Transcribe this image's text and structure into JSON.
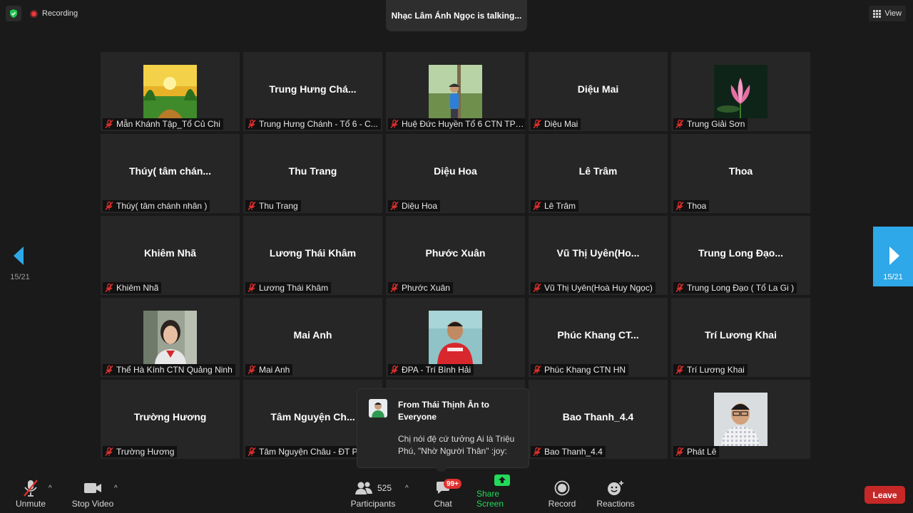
{
  "top": {
    "recording_label": "Recording",
    "talking_text": "Nhạc Lâm Ánh Ngọc is talking...",
    "view_label": "View"
  },
  "pager": {
    "left_label": "15/21",
    "right_label": "15/21"
  },
  "tiles": [
    {
      "big": "",
      "label": "Mẫn Khánh Tập_Tổ Củ Chi",
      "has_photo": true
    },
    {
      "big": "Trung Hưng Chá...",
      "label": "Trung Hưng Chánh - Tổ 6 - C..."
    },
    {
      "big": "",
      "label": "Huệ Đức Huyền Tổ 6 CTN TP ...",
      "has_photo": true
    },
    {
      "big": "Diệu Mai",
      "label": "Diệu Mai"
    },
    {
      "big": "",
      "label": "Trung Giải Sơn",
      "has_photo": true
    },
    {
      "big": "Thúy( tâm chán...",
      "label": "Thúy( tâm chánh nhân )"
    },
    {
      "big": "Thu Trang",
      "label": "Thu Trang"
    },
    {
      "big": "Diệu Hoa",
      "label": "Diệu Hoa"
    },
    {
      "big": "Lê Trâm",
      "label": "Lê Trâm"
    },
    {
      "big": "Thoa",
      "label": "Thoa"
    },
    {
      "big": "Khiêm Nhã",
      "label": "Khiêm Nhã"
    },
    {
      "big": "Lương Thái Khâm",
      "label": "Lương Thái Khâm"
    },
    {
      "big": "Phước Xuân",
      "label": "Phước Xuân"
    },
    {
      "big": "Vũ Thị Uyên(Ho...",
      "label": "Vũ Thị Uyên(Hoà Huy Ngọc)"
    },
    {
      "big": "Trung Long Đạo...",
      "label": "Trung Long Đạo ( Tổ La Gi )"
    },
    {
      "big": "",
      "label": "Thể Hà Kính CTN Quảng Ninh",
      "has_photo": true
    },
    {
      "big": "Mai Anh",
      "label": "Mai Anh"
    },
    {
      "big": "",
      "label": "ĐPA - Trí Bình Hải",
      "has_photo": true
    },
    {
      "big": "Phúc Khang CT...",
      "label": "Phúc Khang CTN HN"
    },
    {
      "big": "Trí Lương Khai",
      "label": "Trí Lương Khai"
    },
    {
      "big": "Trường Hương",
      "label": "Trường Hương"
    },
    {
      "big": "Tâm Nguyện Ch...",
      "label": "Tâm Nguyện Châu - ĐT Pl"
    },
    {
      "big": "",
      "label": ""
    },
    {
      "big": "Bao Thanh_4.4",
      "label": "Bao Thanh_4.4"
    },
    {
      "big": "",
      "label": "Phát Lê",
      "has_photo": true
    }
  ],
  "chat_popup": {
    "from": "From Thái Thịnh Ân to Everyone",
    "message": "Chị nói đệ cứ tưởng Ai là Triệu Phú, \"Nhờ Người Thân\" :joy:"
  },
  "toolbar": {
    "unmute": "Unmute",
    "stop_video": "Stop Video",
    "participants": "Participants",
    "participants_count": "525",
    "chat": "Chat",
    "chat_badge": "99+",
    "share_screen": "Share Screen",
    "record": "Record",
    "reactions": "Reactions",
    "leave": "Leave"
  },
  "colors": {
    "background": "#1a1a1a",
    "tile": "#262626",
    "share_green": "#23d959",
    "accent_blue": "#2ea8e8",
    "leave_red": "#c62828",
    "muted_red": "#e0312f"
  }
}
